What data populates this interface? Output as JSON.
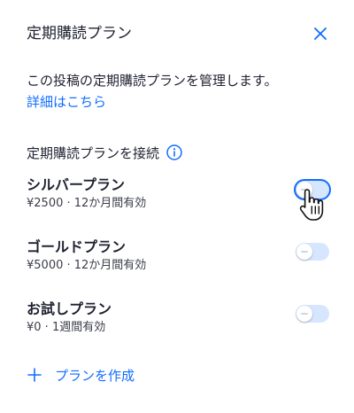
{
  "header": {
    "title": "定期購読プラン",
    "close_icon": "close-icon"
  },
  "description": {
    "text": "この投稿の定期購読プランを管理します。",
    "link": "詳細はこちら"
  },
  "section": {
    "label": "定期購読プランを接続",
    "info_icon": "info-icon"
  },
  "plans": [
    {
      "name": "シルバープラン",
      "detail": "¥2500 · 12か月間有効",
      "connected": false,
      "hovered": true
    },
    {
      "name": "ゴールドプラン",
      "detail": "¥5000 · 12か月間有効",
      "connected": false,
      "hovered": false
    },
    {
      "name": "お試しプラン",
      "detail": "¥0 · 1週間有効",
      "connected": false,
      "hovered": false
    }
  ],
  "create": {
    "label": "プランを作成",
    "icon": "plus-icon"
  },
  "colors": {
    "accent": "#116dff",
    "toggle_off_track": "#d6e6fe",
    "text_primary": "#1f2130",
    "text_secondary": "#3b3d4a"
  }
}
